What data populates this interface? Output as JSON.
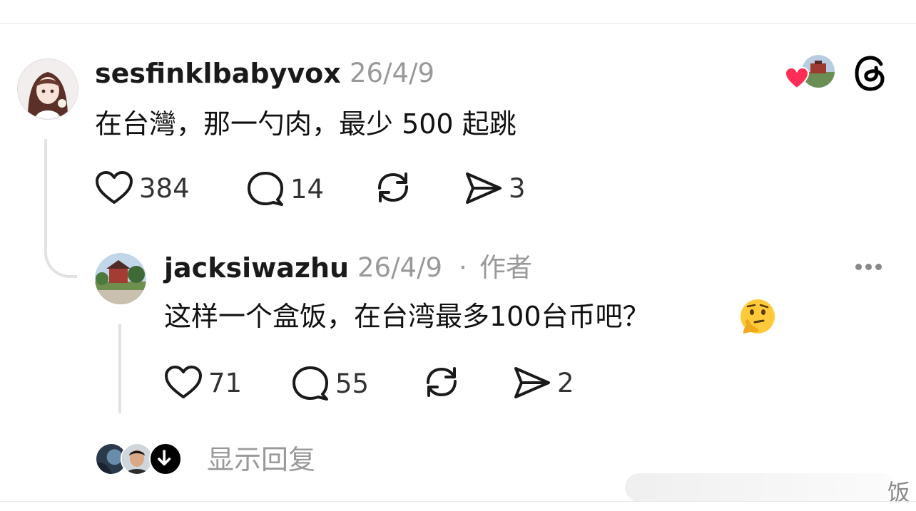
{
  "post": {
    "username": "sesfinklbabyvox",
    "date": "26/4/9",
    "text": "在台灣，那一勺肉，最少 500 起跳",
    "likes": "384",
    "comments": "14",
    "shares": "3"
  },
  "reply": {
    "username": "jacksiwazhu",
    "date": "26/4/9",
    "separator": "·",
    "author_tag": "作者",
    "text": "这样一个盒饭，在台湾最多100台币吧？",
    "emoji": "🤔",
    "likes": "71",
    "comments": "55",
    "shares": "2"
  },
  "footer": {
    "show_replies_label": "显示回复"
  },
  "watermark": {
    "char": "饭"
  },
  "icons": {
    "like": "heart-icon",
    "comment": "comment-bubble-icon",
    "repost": "repost-icon",
    "share": "send-icon",
    "app": "threads-logo-icon",
    "more": "more-dots-icon",
    "down": "arrow-down-icon",
    "liked_badge": "red-heart-badge-icon"
  },
  "colors": {
    "liked_heart": "#ff2d55",
    "muted_text": "#999999",
    "thread_line": "#e2e2e2"
  }
}
